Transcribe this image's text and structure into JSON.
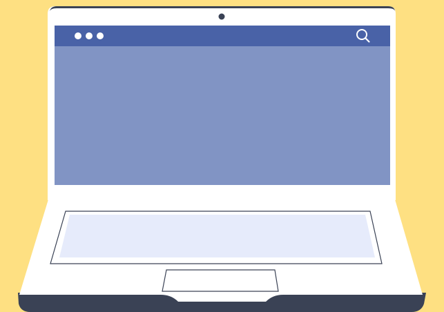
{
  "colors": {
    "background": "#fee082",
    "laptop_body": "#ffffff",
    "laptop_base": "#3a4255",
    "browser_bar": "#4962a7",
    "viewport": "#8194c4",
    "keyboard": "#e6ebfb",
    "outline": "#3a4255",
    "bezel_edge": "#3a4255"
  },
  "icons": {
    "camera": "webcam-icon",
    "search": "search-icon",
    "window_controls": [
      "window-dot-icon",
      "window-dot-icon",
      "window-dot-icon"
    ]
  },
  "browser": {
    "dots": [
      1,
      2,
      3
    ]
  }
}
